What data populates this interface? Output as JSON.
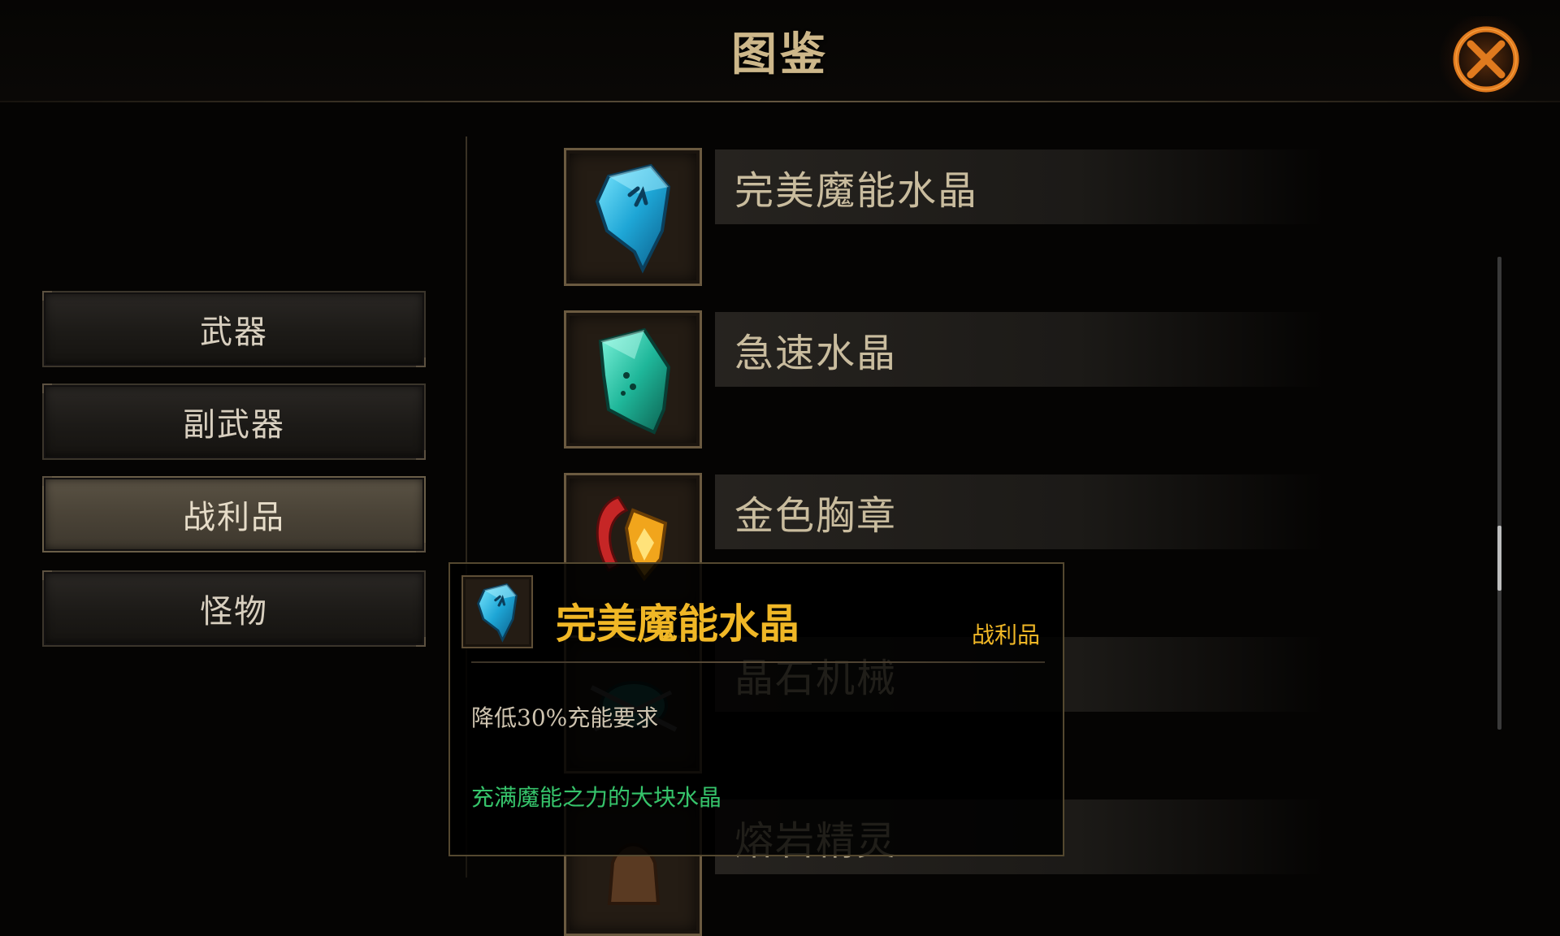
{
  "header": {
    "title": "图鉴",
    "close_icon": "close-x-icon"
  },
  "categories": [
    {
      "label": "武器",
      "active": false
    },
    {
      "label": "副武器",
      "active": false
    },
    {
      "label": "战利品",
      "active": true
    },
    {
      "label": "怪物",
      "active": false
    }
  ],
  "items": [
    {
      "name": "完美魔能水晶",
      "icon": "blue-crystal-icon"
    },
    {
      "name": "急速水晶",
      "icon": "teal-crystal-shard-icon"
    },
    {
      "name": "金色胸章",
      "icon": "gold-badge-icon"
    },
    {
      "name": "晶石机械",
      "icon": "crystal-machine-icon"
    },
    {
      "name": "熔岩精灵",
      "icon": "lava-spirit-icon"
    }
  ],
  "scrollbar": {
    "position": 0.66
  },
  "tooltip": {
    "name": "完美魔能水晶",
    "category": "战利品",
    "effect": "降低30%充能要求",
    "flavor": "充满魔能之力的大块水晶",
    "icon": "blue-crystal-icon"
  },
  "colors": {
    "accent_gold": "#f0b726",
    "flavor_green": "#36c46b",
    "close_glow": "#c85a14"
  }
}
